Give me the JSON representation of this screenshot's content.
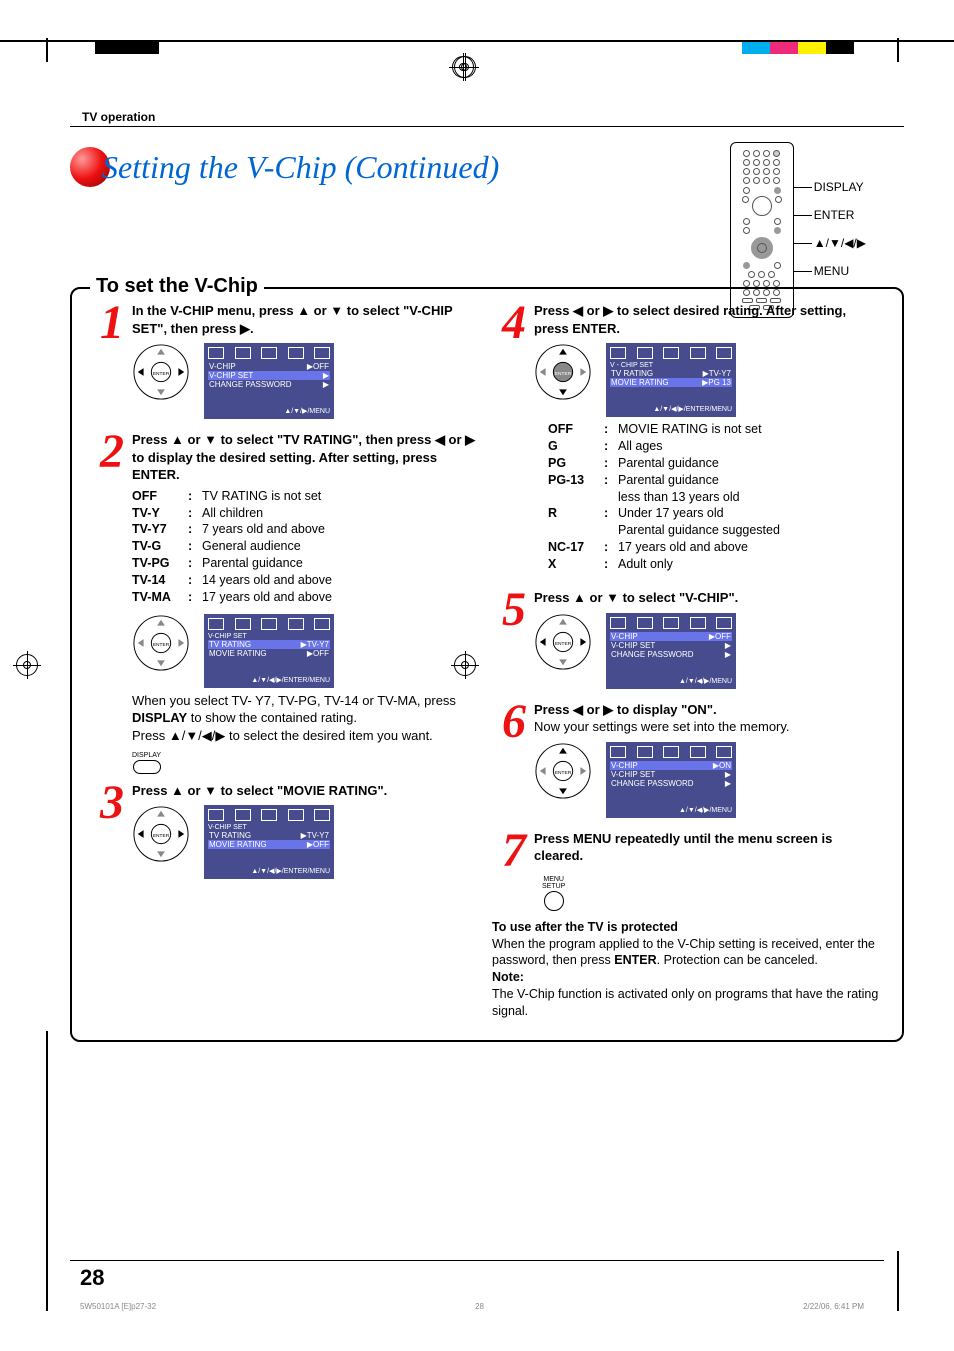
{
  "header": {
    "section_label": "TV operation"
  },
  "title": "Setting the V-Chip (Continued)",
  "remote_labels": [
    "DISPLAY",
    "ENTER",
    "▲/▼/◀/▶",
    "MENU"
  ],
  "box_title": "To set the V-Chip",
  "steps": {
    "s1": {
      "num": "1",
      "instr": "In the V-CHIP menu, press ▲ or ▼ to select \"V-CHIP SET\", then press ▶.",
      "osd": {
        "lines": [
          {
            "l": "V-CHIP",
            "r": "▶OFF",
            "hl": false
          },
          {
            "l": "V-CHIP SET",
            "r": "▶",
            "hl": true
          },
          {
            "l": "CHANGE PASSWORD",
            "r": "▶",
            "hl": false
          }
        ],
        "foot": "▲/▼/▶/MENU"
      }
    },
    "s2": {
      "num": "2",
      "instr": "Press ▲ or ▼  to select \"TV RATING\", then press  ◀ or ▶ to display the desired setting. After setting, press ENTER.",
      "tv_ratings": [
        {
          "code": "OFF",
          "desc": "TV RATING is not set"
        },
        {
          "code": "TV-Y",
          "desc": "All children"
        },
        {
          "code": "TV-Y7",
          "desc": "7 years old and above"
        },
        {
          "code": "TV-G",
          "desc": "General audience"
        },
        {
          "code": "TV-PG",
          "desc": "Parental guidance"
        },
        {
          "code": "TV-14",
          "desc": "14 years old and above"
        },
        {
          "code": "TV-MA",
          "desc": "17 years old and above"
        }
      ],
      "osd": {
        "title": "V-CHIP SET",
        "lines": [
          {
            "l": "TV RATING",
            "r": "▶TV-Y7",
            "hl": true
          },
          {
            "l": "MOVIE RATING",
            "r": "▶OFF",
            "hl": false
          }
        ],
        "foot": "▲/▼/◀/▶/ENTER/MENU"
      },
      "post_p1": "When you select TV- Y7, TV-PG, TV-14 or TV-MA, press ",
      "post_bold": "DISPLAY",
      "post_p2": " to show the contained rating.",
      "post_p3": "Press ▲/▼/◀/▶  to select the desired item you want.",
      "disp_label": "DISPLAY"
    },
    "s3": {
      "num": "3",
      "instr": "Press ▲ or ▼  to select \"MOVIE RATING\".",
      "osd": {
        "title": "V-CHIP SET",
        "lines": [
          {
            "l": "TV RATING",
            "r": "▶TV-Y7",
            "hl": false
          },
          {
            "l": "MOVIE RATING",
            "r": "▶OFF",
            "hl": true
          }
        ],
        "foot": "▲/▼/◀/▶/ENTER/MENU"
      }
    },
    "s4": {
      "num": "4",
      "instr": "Press ◀ or ▶ to select desired rating. After setting, press ENTER.",
      "osd": {
        "title": "V - CHIP  SET",
        "lines": [
          {
            "l": "TV  RATING",
            "r": "▶TV-Y7",
            "hl": false
          },
          {
            "l": "MOVIE  RATING",
            "r": "▶PG 13",
            "hl": true
          }
        ],
        "foot": "▲/▼/◀/▶/ENTER/MENU"
      },
      "movie_ratings": [
        {
          "code": "OFF",
          "desc": "MOVIE RATING is not set"
        },
        {
          "code": "G",
          "desc": "All ages"
        },
        {
          "code": "PG",
          "desc": "Parental guidance"
        },
        {
          "code": "PG-13",
          "desc": "Parental guidance",
          "extra": "less than 13 years old"
        },
        {
          "code": "R",
          "desc": "Under 17 years old",
          "extra": "Parental guidance suggested"
        },
        {
          "code": "NC-17",
          "desc": "17 years old and above"
        },
        {
          "code": "X",
          "desc": "Adult only"
        }
      ]
    },
    "s5": {
      "num": "5",
      "instr": "Press ▲ or ▼  to select \"V-CHIP\".",
      "osd": {
        "lines": [
          {
            "l": "V-CHIP",
            "r": "▶OFF",
            "hl": true
          },
          {
            "l": "V-CHIP SET",
            "r": "▶",
            "hl": false
          },
          {
            "l": "CHANGE PASSWORD",
            "r": "▶",
            "hl": false
          }
        ],
        "foot": "▲/▼/◀/▶/MENU"
      }
    },
    "s6": {
      "num": "6",
      "instr_p1": "Press ◀ or ▶ to display \"ON\".",
      "instr_p2": "Now your settings were set into the memory.",
      "osd": {
        "lines": [
          {
            "l": "V-CHIP",
            "r": "▶ON",
            "hl": true
          },
          {
            "l": "V-CHIP SET",
            "r": "▶",
            "hl": false
          },
          {
            "l": "CHANGE PASSWORD",
            "r": "▶",
            "hl": false
          }
        ],
        "foot": "▲/▼/◀/▶/MENU"
      }
    },
    "s7": {
      "num": "7",
      "instr": "Press MENU repeatedly until the menu screen is cleared.",
      "btn_label": "MENU\nSETUP"
    }
  },
  "after": {
    "head": "To use after the TV is protected",
    "p1a": "When the program applied to the V-Chip setting is received, enter the password, then press ",
    "p1b": "ENTER",
    "p1c": ". Protection can be canceled.",
    "note_head": "Note:",
    "note_body": "The V-Chip function is activated only on programs that have the rating signal."
  },
  "page_number": "28",
  "footer": {
    "left": "5W50101A [E]p27-32",
    "mid": "28",
    "right": "2/22/06, 6:41 PM"
  }
}
